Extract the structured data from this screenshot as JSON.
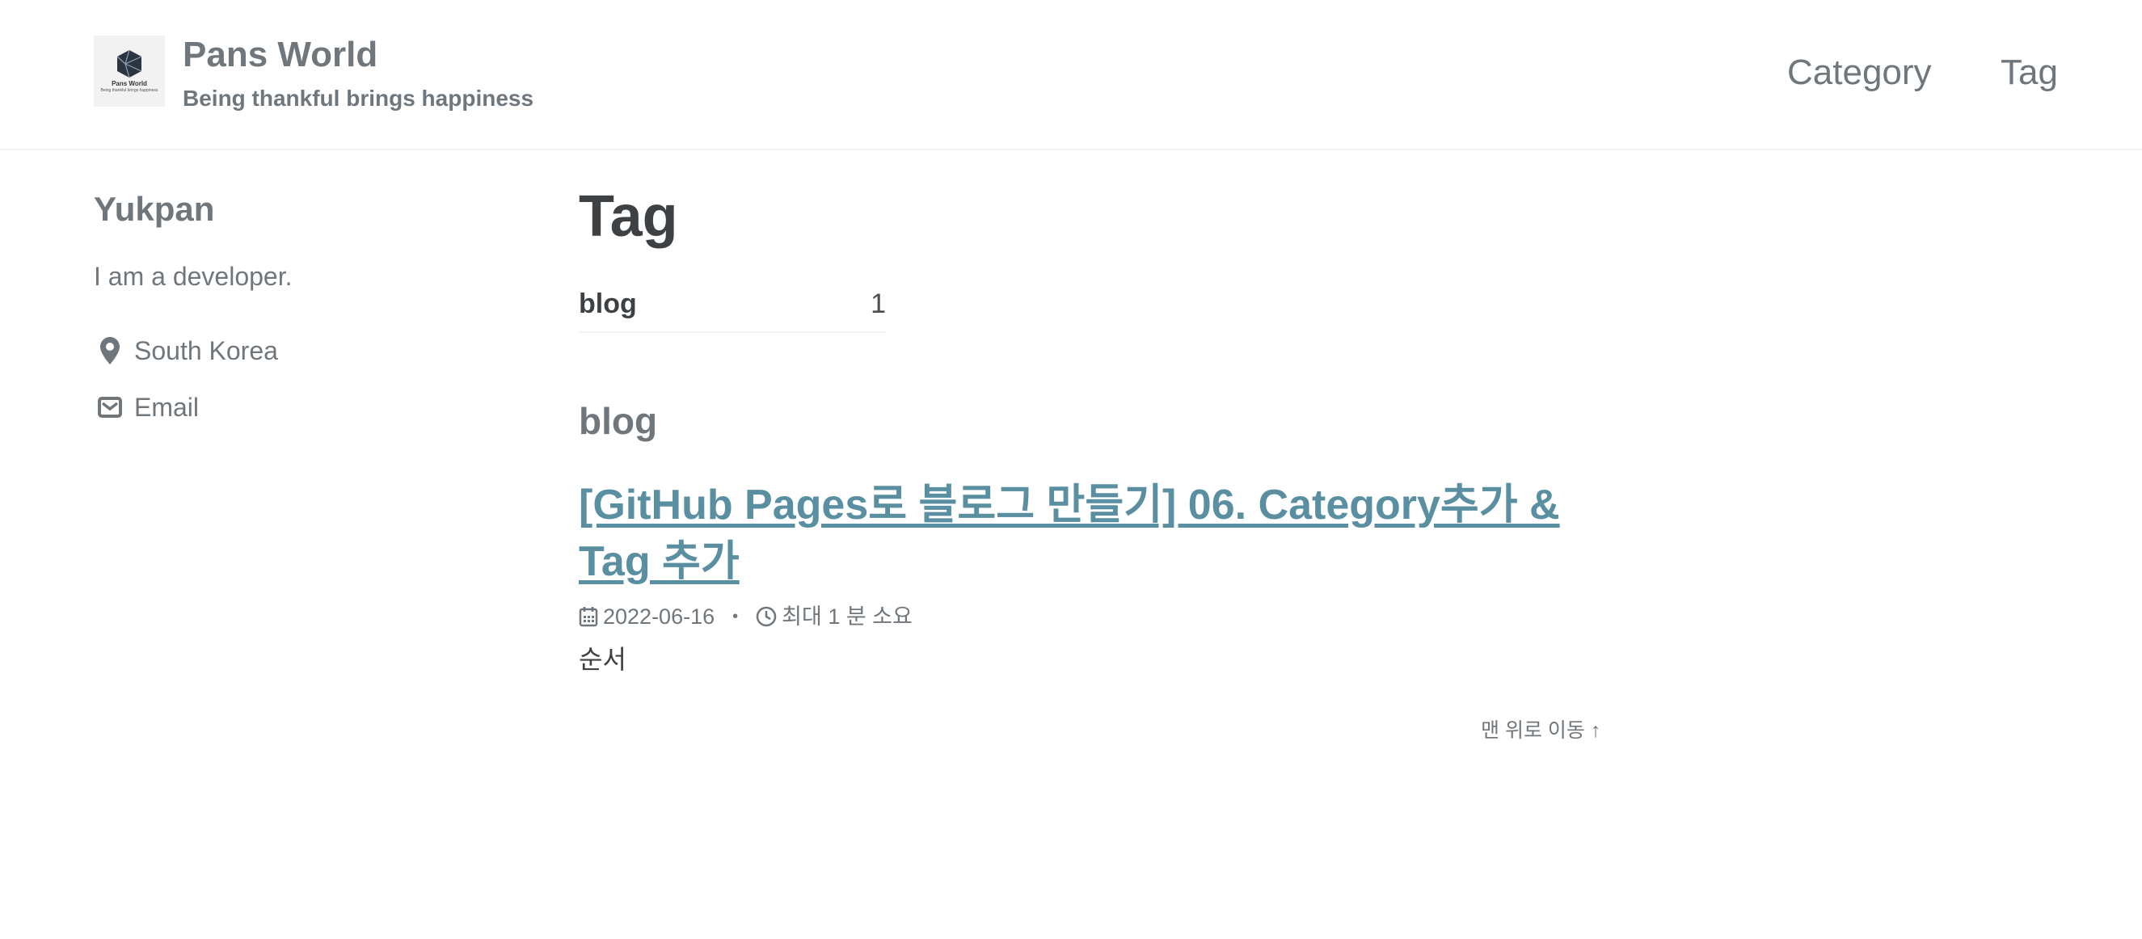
{
  "masthead": {
    "logo": {
      "title": "Pans World",
      "subtitle": "Being thankful brings happiness"
    },
    "site_title": "Pans World",
    "site_subtitle": "Being thankful brings happiness",
    "nav": [
      {
        "label": "Category"
      },
      {
        "label": "Tag"
      }
    ]
  },
  "sidebar": {
    "author_name": "Yukpan",
    "bio": "I am a developer.",
    "links": [
      {
        "icon": "map-marker-icon",
        "label": "South Korea"
      },
      {
        "icon": "envelope-icon",
        "label": "Email"
      }
    ]
  },
  "main": {
    "title": "Tag",
    "taxonomy": [
      {
        "name": "blog",
        "count": "1"
      }
    ],
    "sections": [
      {
        "title": "blog",
        "posts": [
          {
            "title": "[GitHub Pages로 블로그 만들기] 06. Category추가 & Tag 추가",
            "date_icon": "calendar-icon",
            "date": "2022-06-16",
            "separator": "•",
            "read_time_icon": "clock-icon",
            "read_time": "최대 1 분 소요",
            "excerpt": "순서"
          }
        ]
      }
    ],
    "back_to_top": "맨 위로 이동 ↑"
  },
  "colors": {
    "muted_text": "#6f777d",
    "heading_text": "#3d4144",
    "link": "#5a8fa2",
    "border": "#f2f3f3"
  }
}
